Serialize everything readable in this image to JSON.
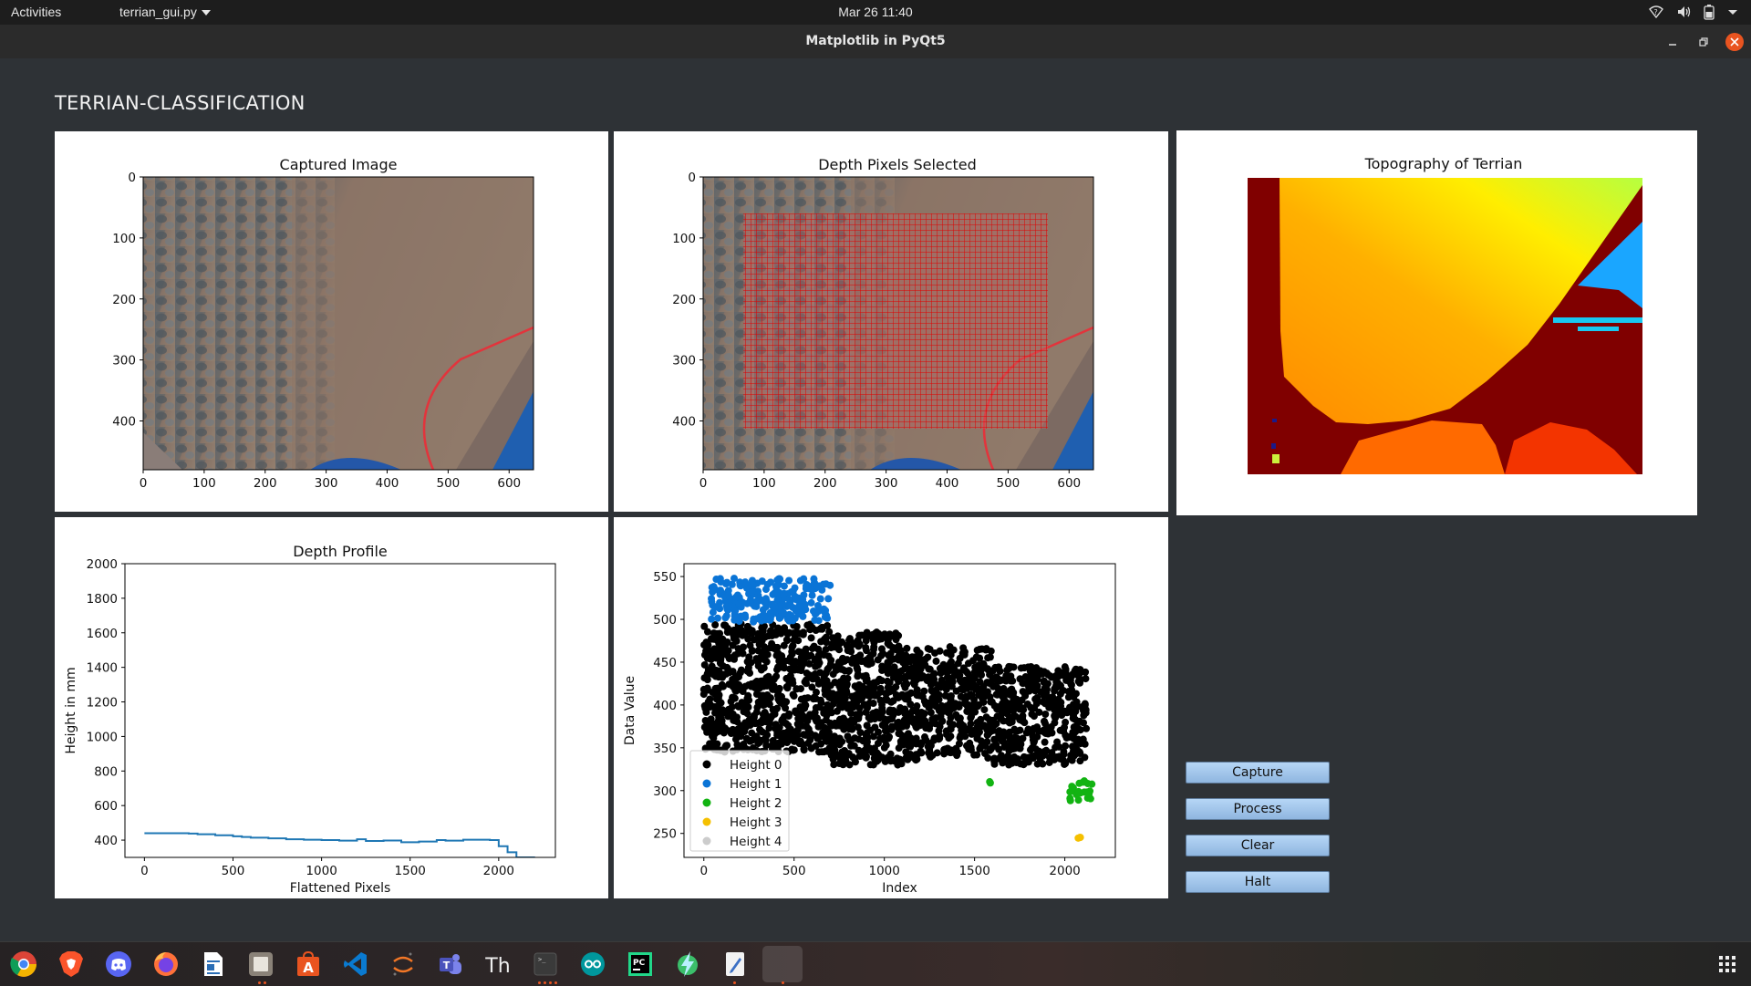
{
  "topbar": {
    "activities": "Activities",
    "app_menu": "terrian_gui.py",
    "clock": "Mar 26  11:40",
    "tray_icons": [
      "wifi-unknown-icon",
      "volume-icon",
      "battery-icon",
      "system-menu-arrow-icon"
    ]
  },
  "window": {
    "title": "Matplotlib in PyQt5",
    "controls": [
      "minimize",
      "maximize",
      "close"
    ]
  },
  "app": {
    "heading": "TERRIAN-CLASSIFICATION",
    "buttons": {
      "capture": "Capture",
      "process": "Process",
      "clear": "Clear",
      "halt": "Halt"
    }
  },
  "panels": {
    "captured": {
      "title": "Captured Image",
      "xticks": [
        "0",
        "100",
        "200",
        "300",
        "400",
        "500",
        "600"
      ],
      "yticks": [
        "0",
        "100",
        "200",
        "300",
        "400"
      ]
    },
    "depth_pixels": {
      "title": "Depth Pixels Selected",
      "xticks": [
        "0",
        "100",
        "200",
        "300",
        "400",
        "500",
        "600"
      ],
      "yticks": [
        "0",
        "100",
        "200",
        "300",
        "400"
      ]
    },
    "topography": {
      "title": "Topography of Terrian"
    }
  },
  "chart_data": [
    {
      "type": "line",
      "title": "Depth Profile",
      "xlabel": "Flattened Pixels",
      "ylabel": "Height in mm",
      "xlim": [
        -110,
        2320
      ],
      "ylim": [
        300,
        2000
      ],
      "xticks": [
        0,
        500,
        1000,
        1500,
        2000
      ],
      "yticks": [
        400,
        600,
        800,
        1000,
        1200,
        1400,
        1600,
        1800,
        2000
      ],
      "series": [
        {
          "name": "depth",
          "color": "#1f77b4",
          "x": [
            0,
            250,
            300,
            400,
            500,
            550,
            600,
            700,
            800,
            900,
            1000,
            1100,
            1200,
            1250,
            1350,
            1450,
            1550,
            1650,
            1700,
            1800,
            1950,
            2000,
            2050,
            2100,
            2150,
            2200
          ],
          "y": [
            440,
            438,
            434,
            428,
            422,
            418,
            414,
            410,
            405,
            402,
            400,
            397,
            405,
            395,
            398,
            388,
            392,
            400,
            397,
            402,
            400,
            365,
            330,
            300,
            300,
            305
          ]
        }
      ]
    },
    {
      "type": "scatter",
      "title": "",
      "xlabel": "Index",
      "ylabel": "Data Value",
      "xlim": [
        -110,
        2280
      ],
      "ylim": [
        222,
        565
      ],
      "xticks": [
        0,
        500,
        1000,
        1500,
        2000
      ],
      "yticks": [
        250,
        300,
        350,
        400,
        450,
        500,
        550
      ],
      "legend": {
        "position": "lower-left",
        "entries": [
          "Height 0",
          "Height 1",
          "Height 2",
          "Height 3",
          "Height 4"
        ]
      },
      "series": [
        {
          "name": "Height 0",
          "color": "#000000",
          "clusters": [
            {
              "x_range": [
                0,
                700
              ],
              "y_range": [
                345,
                495
              ]
            },
            {
              "x_range": [
                700,
                1100
              ],
              "y_range": [
                330,
                485
              ]
            },
            {
              "x_range": [
                1100,
                1600
              ],
              "y_range": [
                335,
                468
              ]
            },
            {
              "x_range": [
                1600,
                2120
              ],
              "y_range": [
                330,
                445
              ]
            }
          ]
        },
        {
          "name": "Height 1",
          "color": "#0a74d6",
          "clusters": [
            {
              "x_range": [
                40,
                700
              ],
              "y_range": [
                497,
                548
              ]
            }
          ]
        },
        {
          "name": "Height 2",
          "color": "#12b312",
          "clusters": [
            {
              "x_range": [
                1580,
                1590
              ],
              "y_range": [
                308,
                312
              ]
            },
            {
              "x_range": [
                2020,
                2150
              ],
              "y_range": [
                288,
                313
              ]
            }
          ]
        },
        {
          "name": "Height 3",
          "color": "#f5c000",
          "clusters": [
            {
              "x_range": [
                2010,
                2090
              ],
              "y_range": [
                241,
                246
              ]
            }
          ]
        },
        {
          "name": "Height 4",
          "color": "#cccccc",
          "clusters": []
        }
      ]
    }
  ],
  "dock": {
    "items": [
      "chrome",
      "brave",
      "discord",
      "firefox",
      "libreoffice-writer",
      "files",
      "app-center",
      "vscode",
      "jupyter",
      "teams",
      "thonny",
      "terminal",
      "arduino",
      "pycharm",
      "power-app",
      "text-editor",
      "running-app"
    ],
    "show_apps": "show-applications-icon"
  }
}
